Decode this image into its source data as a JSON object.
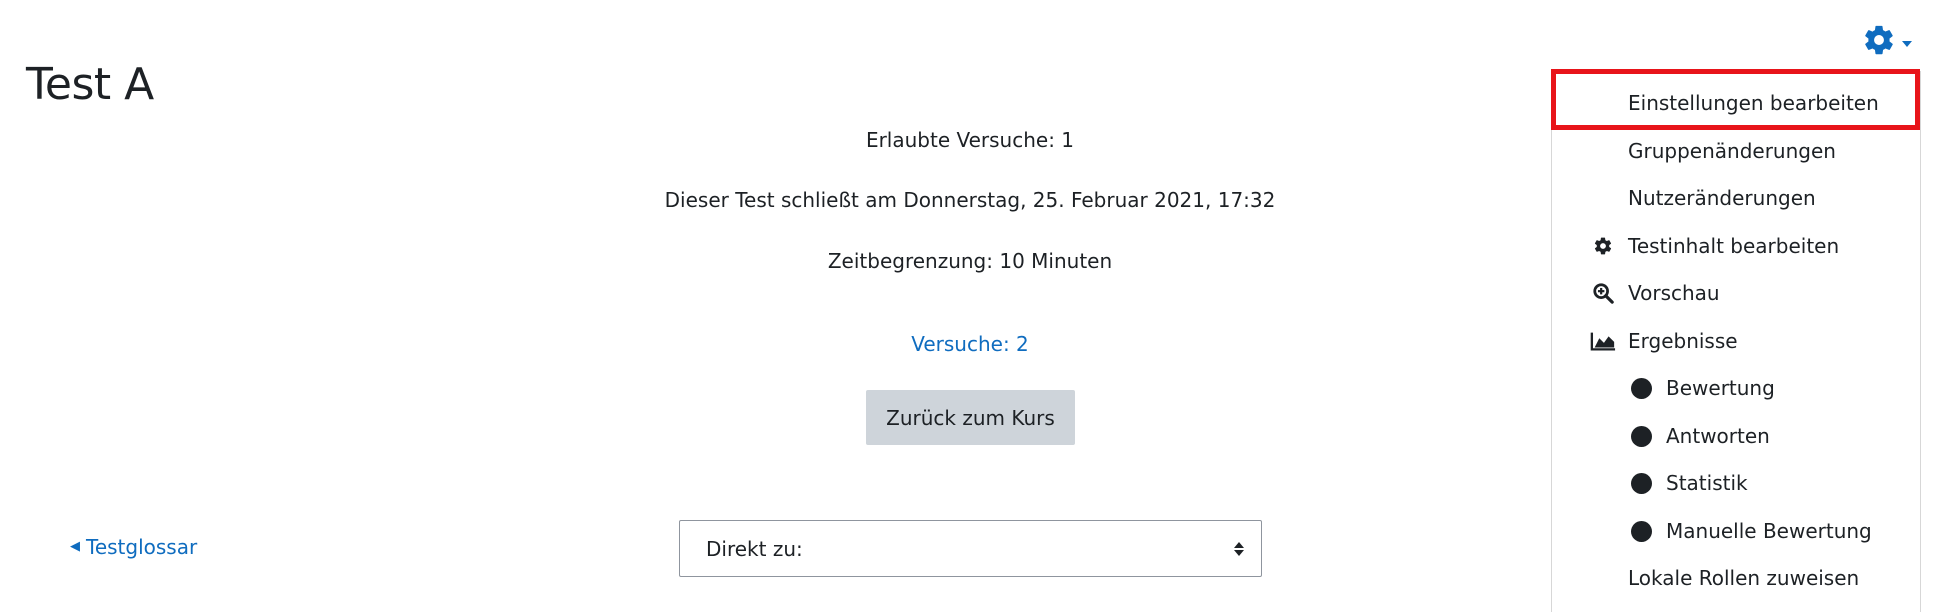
{
  "page": {
    "title": "Test A"
  },
  "quiz_info": {
    "attempts_allowed": "Erlaubte Versuche: 1",
    "closes": "Dieser Test schließt am Donnerstag, 25. Februar 2021, 17:32",
    "time_limit": "Zeitbegrenzung: 10 Minuten",
    "attempts_link": "Versuche: 2",
    "back_button": "Zurück zum Kurs"
  },
  "navigation": {
    "prev_link": "Testglossar",
    "jump_select_value": "Direkt zu:"
  },
  "settings_menu": {
    "toggle_icon": "gear-icon",
    "items": [
      {
        "label": "Einstellungen bearbeiten",
        "icon": null
      },
      {
        "label": "Gruppenänderungen",
        "icon": null
      },
      {
        "label": "Nutzeränderungen",
        "icon": null
      },
      {
        "label": "Testinhalt bearbeiten",
        "icon": "gear-icon"
      },
      {
        "label": "Vorschau",
        "icon": "zoom-in-icon"
      },
      {
        "label": "Ergebnisse",
        "icon": "area-chart-icon"
      },
      {
        "label": "Bewertung",
        "icon": "circle-icon"
      },
      {
        "label": "Antworten",
        "icon": "circle-icon"
      },
      {
        "label": "Statistik",
        "icon": "circle-icon"
      },
      {
        "label": "Manuelle Bewertung",
        "icon": "circle-icon"
      },
      {
        "label": "Lokale Rollen zuweisen",
        "icon": null
      }
    ]
  },
  "colors": {
    "link": "#0f6cbf",
    "highlight": "#e8141a",
    "button_bg": "#ced4da",
    "text": "#1d2125"
  }
}
